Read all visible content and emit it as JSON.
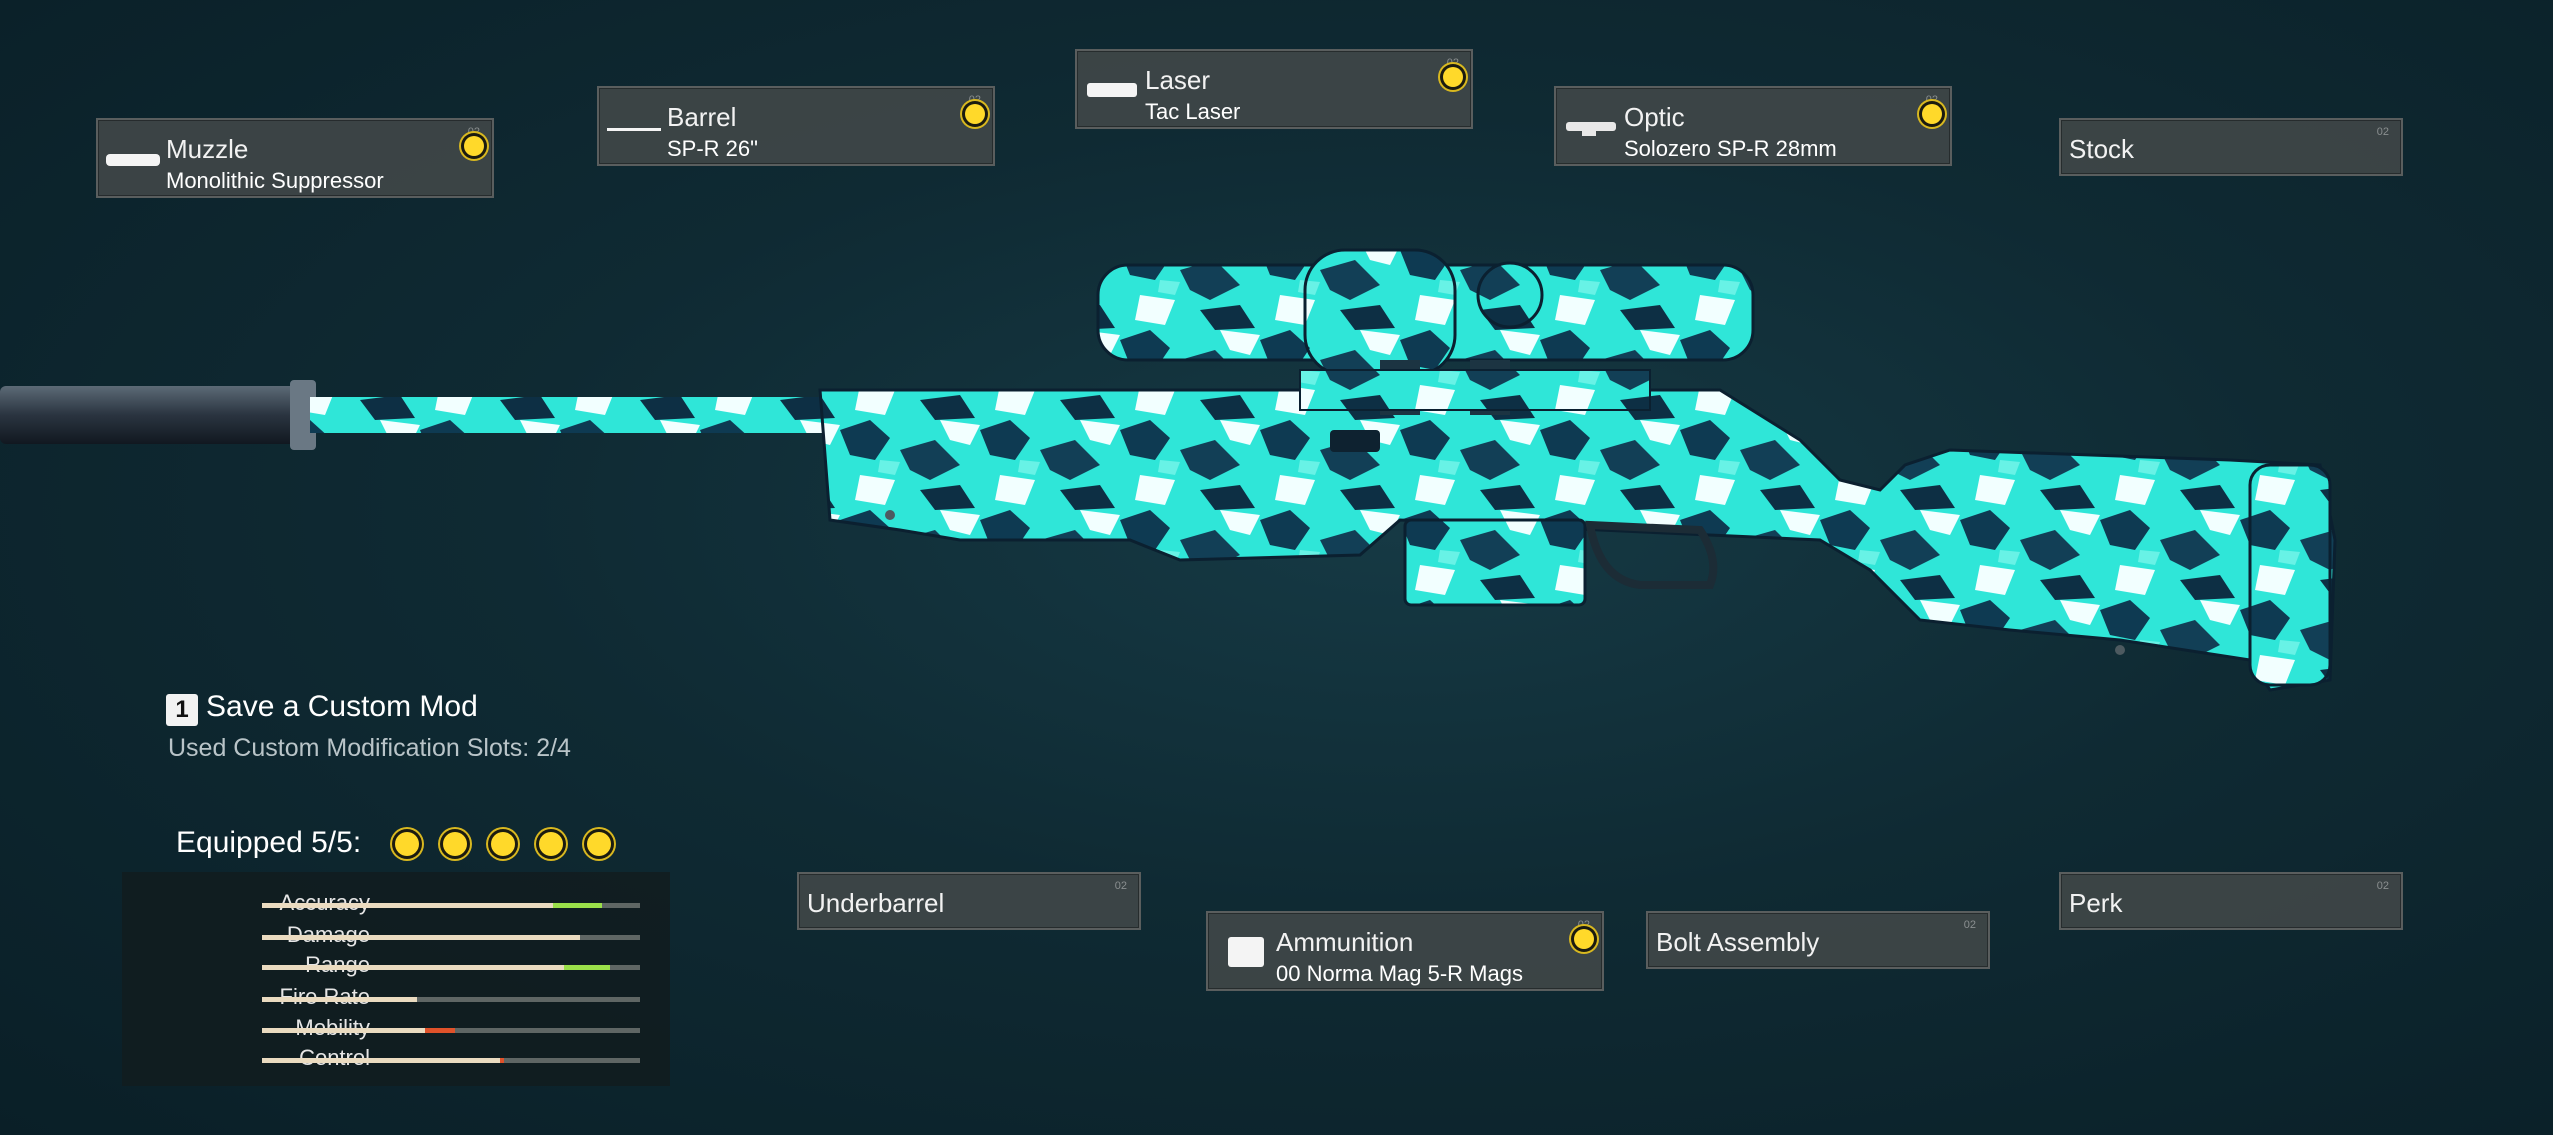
{
  "attachments": [
    {
      "name": "Muzzle",
      "value": "Monolithic Suppressor",
      "tag": "02",
      "equipped": true,
      "icon": "suppressor-icon"
    },
    {
      "name": "Barrel",
      "value": "SP-R 26\"",
      "tag": "02",
      "equipped": true,
      "icon": "barrel-icon"
    },
    {
      "name": "Laser",
      "value": "Tac Laser",
      "tag": "02",
      "equipped": true,
      "icon": "laser-icon"
    },
    {
      "name": "Optic",
      "value": "Solozero SP-R 28mm",
      "tag": "02",
      "equipped": true,
      "icon": "scope-icon"
    },
    {
      "name": "Stock",
      "value": "",
      "tag": "02",
      "equipped": false
    },
    {
      "name": "Underbarrel",
      "value": "",
      "tag": "02",
      "equipped": false
    },
    {
      "name": "Ammunition",
      "value": "00 Norma Mag 5-R Mags",
      "tag": "02",
      "equipped": true,
      "icon": "ammo-icon"
    },
    {
      "name": "Bolt Assembly",
      "value": "",
      "tag": "02",
      "equipped": false
    },
    {
      "name": "Perk",
      "value": "",
      "tag": "02",
      "equipped": false
    }
  ],
  "custom_mod": {
    "key": "1",
    "label": "Save a Custom Mod",
    "slots_text": "Used Custom Modification Slots: 2/4"
  },
  "equipped": {
    "label": "Equipped 5/5:",
    "count": 5
  },
  "stats": [
    {
      "name": "Accuracy",
      "base": 0.77,
      "modified": 0.9,
      "change": "increase"
    },
    {
      "name": "Damage",
      "base": 0.84,
      "modified": 0.84,
      "change": "none"
    },
    {
      "name": "Range",
      "base": 0.8,
      "modified": 0.92,
      "change": "increase"
    },
    {
      "name": "Fire Rate",
      "base": 0.41,
      "modified": 0.41,
      "change": "none"
    },
    {
      "name": "Mobility",
      "base": 0.43,
      "modified": 0.51,
      "change": "decrease"
    },
    {
      "name": "Control",
      "base": 0.63,
      "modified": 0.64,
      "change": "decrease"
    }
  ],
  "colors": {
    "equipped_dot": "#ffd92a",
    "increase": "#9be04a",
    "decrease": "#e0522a",
    "camo_primary": "#2fe6d8",
    "camo_dark": "#0e3a52"
  }
}
